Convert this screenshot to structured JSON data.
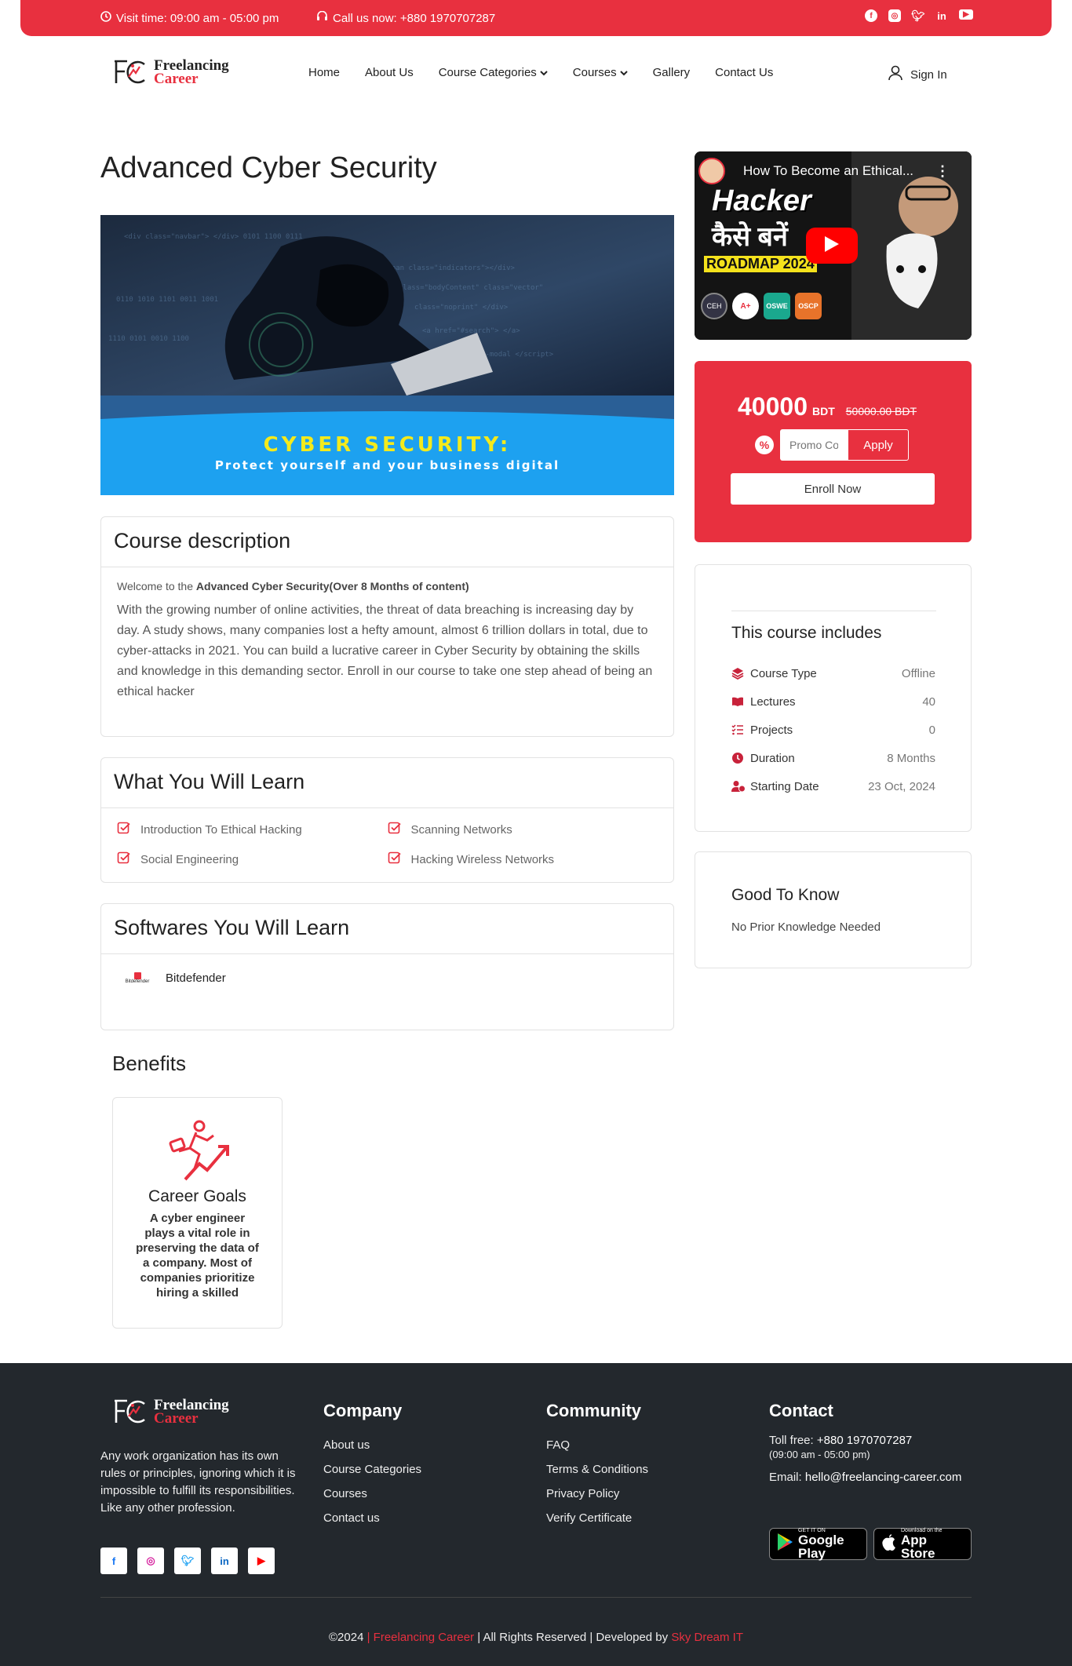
{
  "topbar": {
    "visit_time": "Visit time: 09:00 am - 05:00 pm",
    "call": "Call us now: +880 1970707287",
    "socials": [
      "facebook-icon",
      "instagram-icon",
      "twitter-icon",
      "linkedin-icon",
      "youtube-icon"
    ]
  },
  "brand": {
    "line1": "Freelancing",
    "line2": "Career"
  },
  "nav": {
    "items": [
      "Home",
      "About Us",
      "Course Categories",
      "Courses",
      "Gallery",
      "Contact Us"
    ],
    "sign_in": "Sign In"
  },
  "course": {
    "title": "Advanced Cyber Security",
    "banner_line1": "CYBER SECURITY:",
    "banner_line2": "Protect yourself and your business digital"
  },
  "description": {
    "heading": "Course description",
    "intro_prefix": "Welcome to the ",
    "intro_bold": "Advanced Cyber Security(Over 8 Months of content)",
    "body": "With the growing number of online activities, the threat of data breaching is increasing day by day. A study shows, many companies lost a hefty amount, almost 6 trillion dollars in total, due to cyber-attacks in 2021. You can build a lucrative career in Cyber Security by obtaining the skills and knowledge in this demanding sector. Enroll in our course to take one step ahead of being an ethical hacker"
  },
  "learn": {
    "heading": "What You Will Learn",
    "items": [
      "Introduction To Ethical Hacking",
      "Scanning Networks",
      "Social Engineering",
      "Hacking Wireless Networks"
    ]
  },
  "softwares": {
    "heading": "Softwares You Will Learn",
    "items": [
      {
        "name": "Bitdefender",
        "logo_text": "Bitdefender"
      }
    ]
  },
  "benefits": {
    "heading": "Benefits",
    "items": [
      {
        "title": "Career Goals",
        "text": "A cyber engineer plays a vital role in preserving the data of a company. Most of companies prioritize hiring a skilled"
      }
    ]
  },
  "video": {
    "title": "How To Become an Ethical...",
    "thumb_line1": "Hacker",
    "thumb_line2": "कैसे बनें",
    "thumb_line3": "ROADMAP 2024",
    "badges": [
      "CEH",
      "A+",
      "OSWE",
      "OSCP"
    ]
  },
  "pricing": {
    "price": "40000",
    "currency": "BDT",
    "old_price": "50000.00 BDT",
    "promo_placeholder": "Promo Code",
    "apply": "Apply",
    "enroll": "Enroll Now"
  },
  "includes": {
    "heading": "This course includes",
    "rows": [
      {
        "label": "Course Type",
        "value": "Offline",
        "icon": "layers-icon"
      },
      {
        "label": "Lectures",
        "value": "40",
        "icon": "book-icon"
      },
      {
        "label": "Projects",
        "value": "0",
        "icon": "checklist-icon"
      },
      {
        "label": "Duration",
        "value": "8 Months",
        "icon": "clock-icon"
      },
      {
        "label": "Starting Date",
        "value": "23 Oct, 2024",
        "icon": "user-clock-icon"
      }
    ]
  },
  "good_to_know": {
    "heading": "Good To Know",
    "text": "No Prior Knowledge Needed"
  },
  "footer": {
    "about": "Any work organization has its own rules or principles, ignoring which it is impossible to fulfill its responsibilities. Like any other profession.",
    "company": {
      "heading": "Company",
      "links": [
        "About us",
        "Course Categories",
        "Courses",
        "Contact us"
      ]
    },
    "community": {
      "heading": "Community",
      "links": [
        "FAQ",
        "Terms & Conditions",
        "Privacy Policy",
        "Verify Certificate"
      ]
    },
    "contact": {
      "heading": "Contact",
      "toll_label": "Toll free:",
      "toll_number": "+880 1970707287",
      "hours": "(09:00 am - 05:00 pm)",
      "email_label": "Email:",
      "email": "hello@freelancing-career.com"
    },
    "google_play": {
      "small": "GET IT ON",
      "big": "Google Play"
    },
    "app_store": {
      "small": "Download on the",
      "big": "App Store"
    },
    "copyright": "©2024",
    "brand": "Freelancing Career",
    "rights": "All Rights Reserved",
    "dev_prefix": "Developed by",
    "developer": "Sky Dream IT"
  },
  "colors": {
    "accent": "#e8303f",
    "footer_bg": "#23282d"
  }
}
